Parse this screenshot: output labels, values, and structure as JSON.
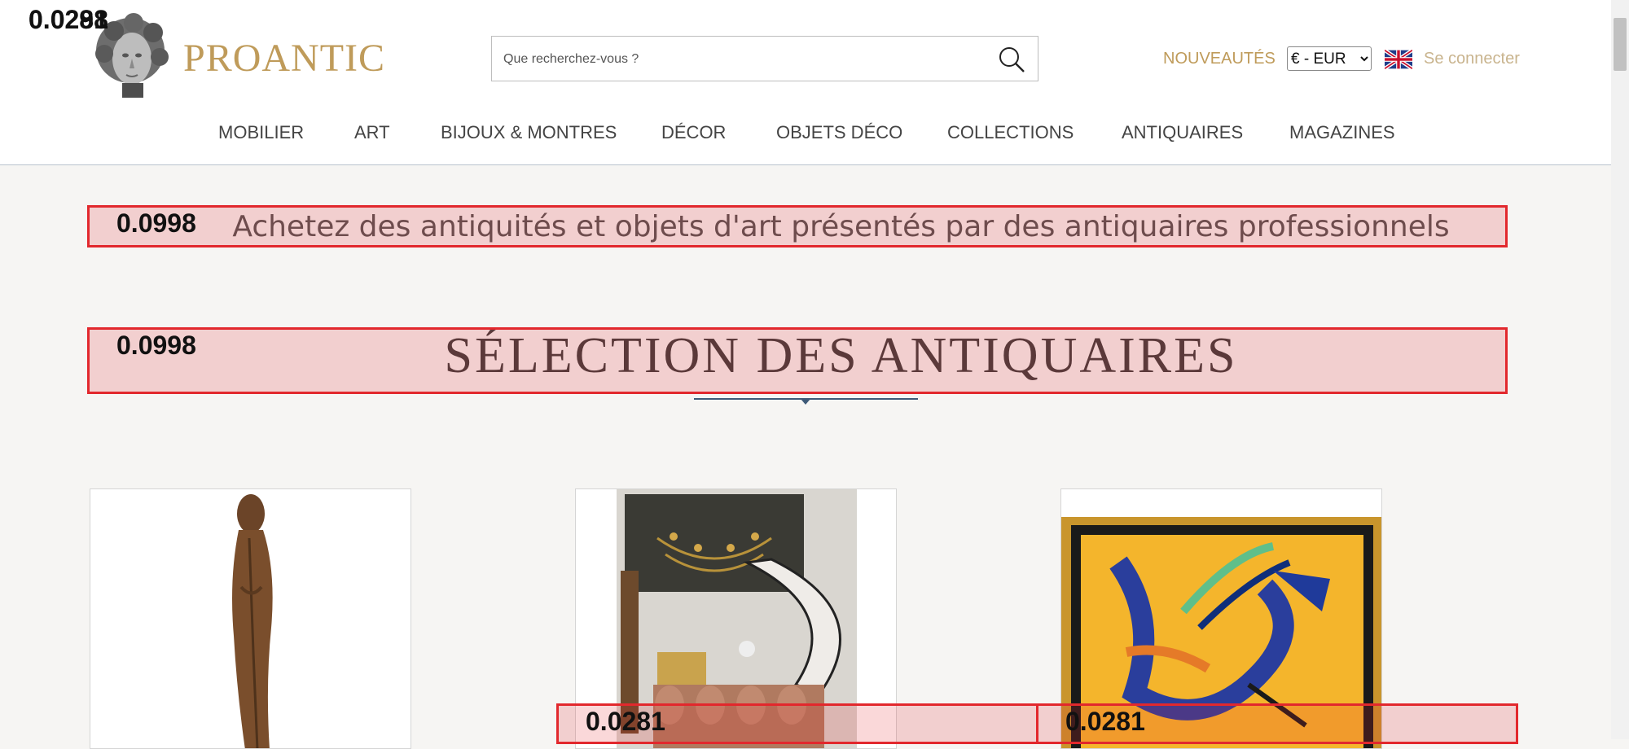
{
  "brand": {
    "name": "PROANTIC"
  },
  "search": {
    "placeholder": "Que recherchez-vous ?",
    "icon": "magnifier"
  },
  "header": {
    "new_label": "NOUVEAUTÉS",
    "currency_options": [
      "€ - EUR"
    ],
    "currency_selected": "€ - EUR",
    "language_flag": "uk-flag",
    "login_label": "Se connecter"
  },
  "nav": {
    "items": [
      "MOBILIER",
      "ART",
      "BIJOUX & MONTRES",
      "DÉCOR",
      "OBJETS DÉCO",
      "COLLECTIONS",
      "ANTIQUAIRES",
      "MAGAZINES"
    ]
  },
  "main": {
    "tagline": "Achetez des antiquités et objets d'art présentés par des antiquaires professionnels",
    "section_title": "SÉLECTION DES ANTIQUAIRES"
  },
  "overlays": {
    "corner_scores": [
      "0.0298",
      "0.0281"
    ],
    "tagline_score": "0.0998",
    "title_score": "0.0998",
    "card2_score": "0.0281",
    "card3_score": "0.0281"
  },
  "colors": {
    "gold": "#bf9b5a",
    "overlay_red": "#e2282d",
    "background": "#f6f5f3"
  }
}
